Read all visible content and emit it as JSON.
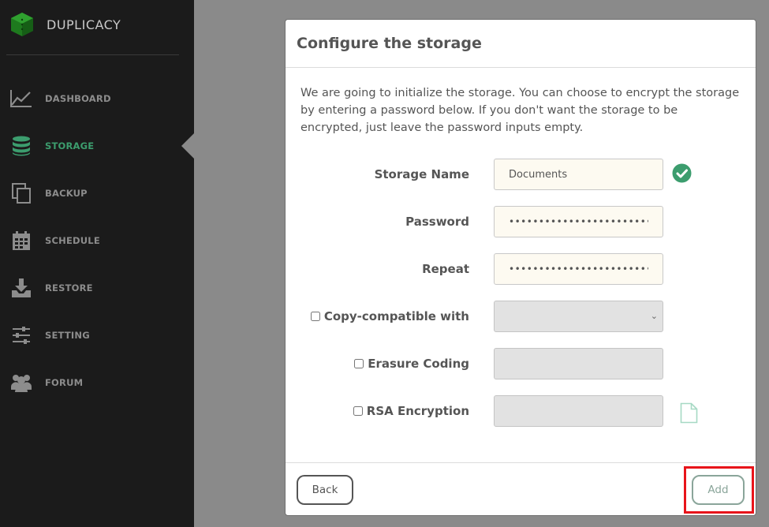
{
  "app": {
    "brand": "DUPLICACY",
    "accent_color": "#3c9d6e"
  },
  "sidebar": {
    "items": [
      {
        "label": "DASHBOARD",
        "icon": "line-chart-icon",
        "active": false
      },
      {
        "label": "STORAGE",
        "icon": "database-icon",
        "active": true
      },
      {
        "label": "BACKUP",
        "icon": "copy-icon",
        "active": false
      },
      {
        "label": "SCHEDULE",
        "icon": "calendar-icon",
        "active": false
      },
      {
        "label": "RESTORE",
        "icon": "download-tray-icon",
        "active": false
      },
      {
        "label": "SETTING",
        "icon": "sliders-icon",
        "active": false
      },
      {
        "label": "FORUM",
        "icon": "users-icon",
        "active": false
      }
    ]
  },
  "dialog": {
    "title": "Configure the storage",
    "intro": "We are going to initialize the storage. You can choose to encrypt the storage by entering a password below. If you don't want the storage to be encrypted, just leave the password inputs empty.",
    "fields": {
      "storage_name": {
        "label": "Storage Name",
        "value": "Documents",
        "valid_icon": "check-circle-icon"
      },
      "password": {
        "label": "Password",
        "value": "••••••••••••••••••••••••"
      },
      "repeat": {
        "label": "Repeat",
        "value": "••••••••••••••••••••••••"
      },
      "copy_compatible": {
        "label": "Copy-compatible with",
        "checked": false,
        "selected": ""
      },
      "erasure_coding": {
        "label": "Erasure Coding",
        "checked": false,
        "value": ""
      },
      "rsa_encryption": {
        "label": "RSA Encryption",
        "checked": false,
        "value": "",
        "file_icon": "file-icon"
      }
    },
    "buttons": {
      "back": "Back",
      "add": "Add"
    }
  }
}
